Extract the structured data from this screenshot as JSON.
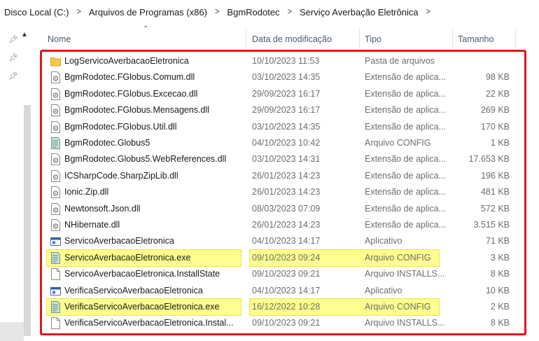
{
  "breadcrumb": [
    "Disco Local (C:)",
    "Arquivos de Programas (x86)",
    "BgmRodotec",
    "Serviço Averbação Eletrônica"
  ],
  "columns": {
    "name": "Nome",
    "date": "Data de modificação",
    "type": "Tipo",
    "size": "Tamanho"
  },
  "files": [
    {
      "name": "LogServicoAverbacaoEletronica",
      "date": "10/10/2023 11:53",
      "type": "Pasta de arquivos",
      "size": "",
      "icon": "folder-icon",
      "highlight": false
    },
    {
      "name": "BgmRodotec.FGlobus.Comum.dll",
      "date": "03/10/2023 14:35",
      "type": "Extensão de aplica...",
      "size": "98 KB",
      "icon": "dll-file-icon",
      "highlight": false
    },
    {
      "name": "BgmRodotec.FGlobus.Excecao.dll",
      "date": "29/09/2023 16:17",
      "type": "Extensão de aplica...",
      "size": "22 KB",
      "icon": "dll-file-icon",
      "highlight": false
    },
    {
      "name": "BgmRodotec.FGlobus.Mensagens.dll",
      "date": "29/09/2023 16:17",
      "type": "Extensão de aplica...",
      "size": "269 KB",
      "icon": "dll-file-icon",
      "highlight": false
    },
    {
      "name": "BgmRodotec.FGlobus.Util.dll",
      "date": "03/10/2023 14:35",
      "type": "Extensão de aplica...",
      "size": "170 KB",
      "icon": "dll-file-icon",
      "highlight": false
    },
    {
      "name": "BgmRodotec.Globus5",
      "date": "04/10/2023 10:42",
      "type": "Arquivo CONFIG",
      "size": "1 KB",
      "icon": "config-file-icon",
      "highlight": false
    },
    {
      "name": "BgmRodotec.Globus5.WebReferences.dll",
      "date": "03/10/2023 14:31",
      "type": "Extensão de aplica...",
      "size": "17.653 KB",
      "icon": "dll-file-icon",
      "highlight": false
    },
    {
      "name": "ICSharpCode.SharpZipLib.dll",
      "date": "26/01/2023 14:23",
      "type": "Extensão de aplica...",
      "size": "196 KB",
      "icon": "dll-file-icon",
      "highlight": false
    },
    {
      "name": "Ionic.Zip.dll",
      "date": "26/01/2023 14:23",
      "type": "Extensão de aplica...",
      "size": "481 KB",
      "icon": "dll-file-icon",
      "highlight": false
    },
    {
      "name": "Newtonsoft.Json.dll",
      "date": "08/03/2023 07:09",
      "type": "Extensão de aplica...",
      "size": "572 KB",
      "icon": "dll-file-icon",
      "highlight": false
    },
    {
      "name": "NHibernate.dll",
      "date": "26/01/2023 14:23",
      "type": "Extensão de aplica...",
      "size": "3.515 KB",
      "icon": "dll-file-icon",
      "highlight": false
    },
    {
      "name": "ServicoAverbacaoEletronica",
      "date": "04/10/2023 14:17",
      "type": "Aplicativo",
      "size": "71 KB",
      "icon": "application-icon",
      "highlight": false
    },
    {
      "name": "ServicoAverbacaoEletronica.exe",
      "date": "09/10/2023 09:24",
      "type": "Arquivo CONFIG",
      "size": "3 KB",
      "icon": "config-file-icon",
      "highlight": true
    },
    {
      "name": "ServicoAverbacaoEletronica.InstallState",
      "date": "09/10/2023 09:21",
      "type": "Arquivo INSTALLS...",
      "size": "8 KB",
      "icon": "blank-file-icon",
      "highlight": false
    },
    {
      "name": "VerificaServicoAverbacaoEletronica",
      "date": "04/10/2023 14:17",
      "type": "Aplicativo",
      "size": "10 KB",
      "icon": "application-icon",
      "highlight": false
    },
    {
      "name": "VerificaServicoAverbacaoEletronica.exe",
      "date": "16/12/2022 10:28",
      "type": "Arquivo CONFIG",
      "size": "2 KB",
      "icon": "config-file-icon",
      "highlight": true
    },
    {
      "name": "VerificaServicoAverbacaoEletronica.Instal...",
      "date": "09/10/2023 09:21",
      "type": "Arquivo INSTALLS...",
      "size": "8 KB",
      "icon": "blank-file-icon",
      "highlight": false
    }
  ],
  "colors": {
    "highlight": "#fefe8e",
    "annotation_box": "#e0151b",
    "folder": "#f2c94c"
  }
}
